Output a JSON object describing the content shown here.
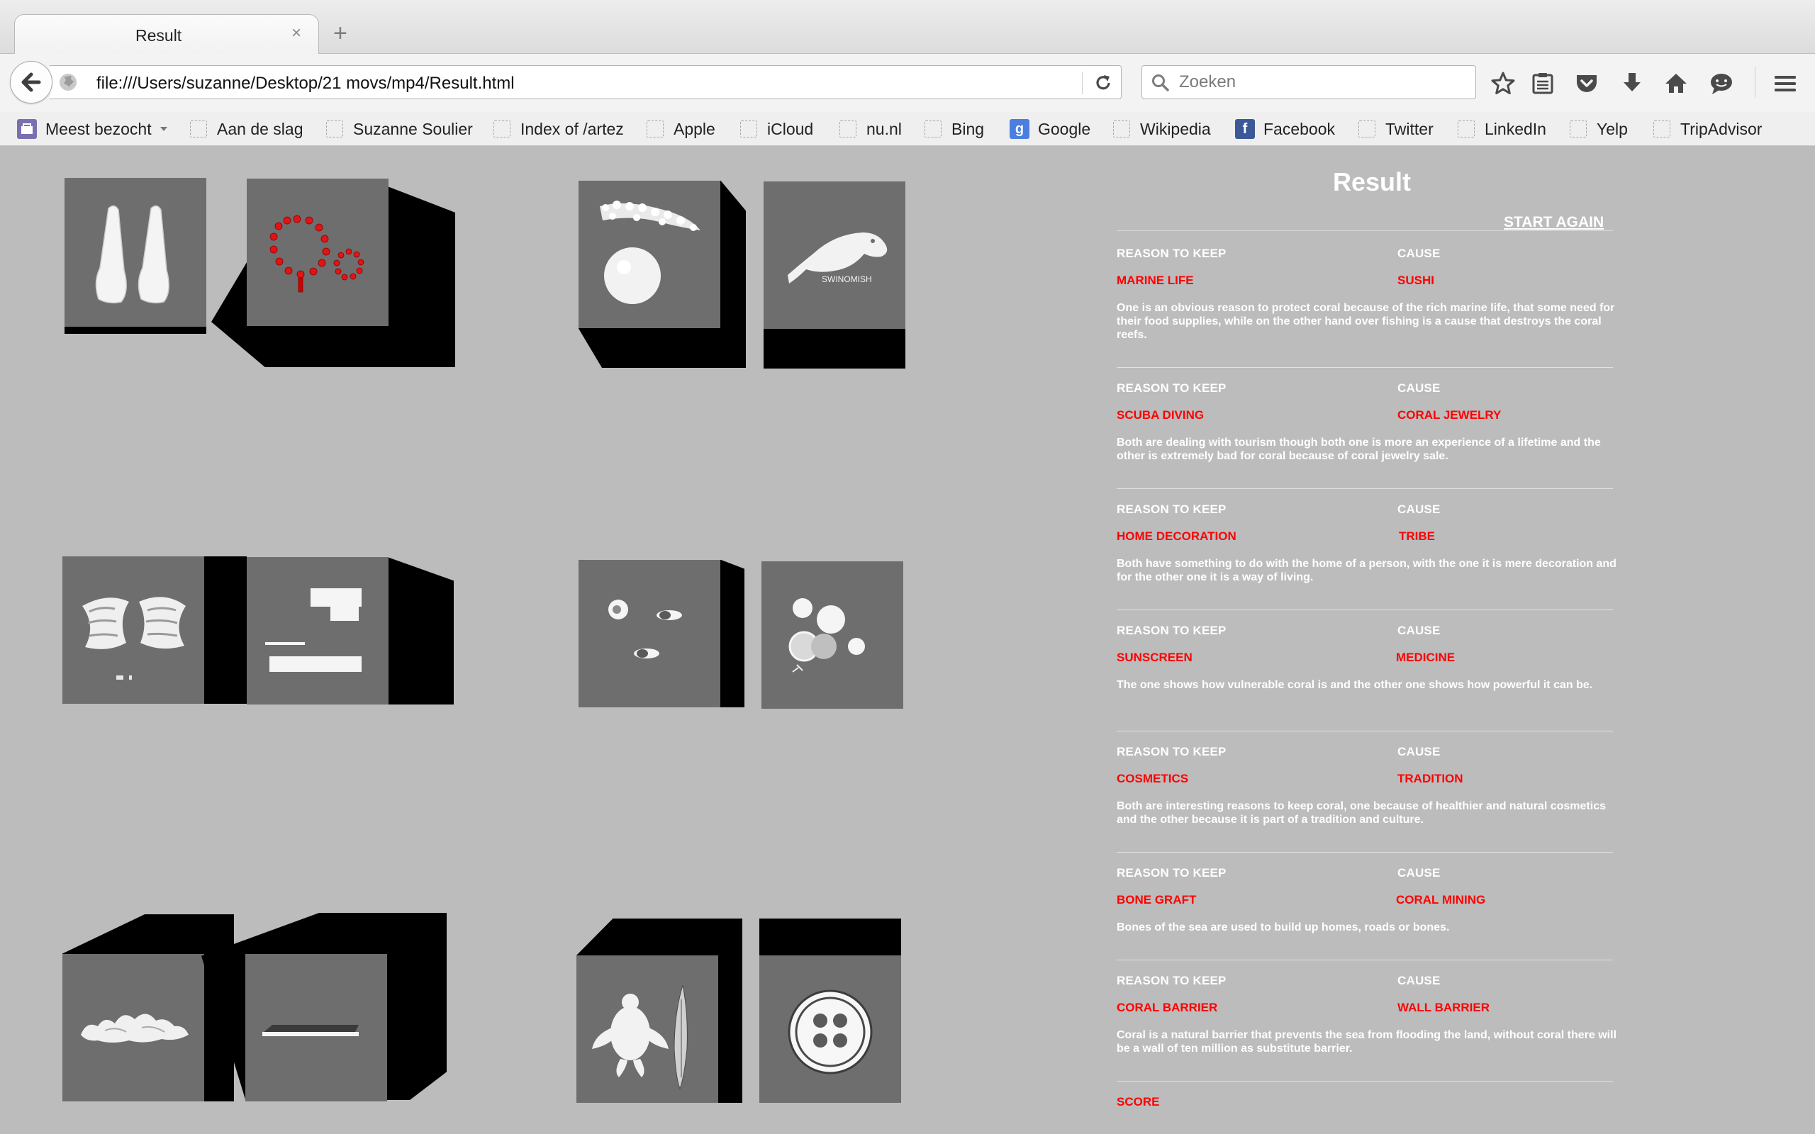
{
  "browser": {
    "tab_title": "Result",
    "tab_close": "×",
    "new_tab": "+",
    "url": "file:///Users/suzanne/Desktop/21 movs/mp4/Result.html",
    "search_placeholder": "Zoeken"
  },
  "bookmarks": [
    {
      "label": "Meest bezocht",
      "icon": "most-visited-icon"
    },
    {
      "label": "Aan de slag",
      "icon": "placeholder"
    },
    {
      "label": "Suzanne Soulier",
      "icon": "placeholder"
    },
    {
      "label": "Index of /artez",
      "icon": "placeholder"
    },
    {
      "label": "Apple",
      "icon": "placeholder"
    },
    {
      "label": "iCloud",
      "icon": "placeholder"
    },
    {
      "label": "nu.nl",
      "icon": "placeholder"
    },
    {
      "label": "Bing",
      "icon": "placeholder"
    },
    {
      "label": "Google",
      "icon": "google-icon"
    },
    {
      "label": "Wikipedia",
      "icon": "placeholder"
    },
    {
      "label": "Facebook",
      "icon": "facebook-icon"
    },
    {
      "label": "Twitter",
      "icon": "placeholder"
    },
    {
      "label": "LinkedIn",
      "icon": "placeholder"
    },
    {
      "label": "Yelp",
      "icon": "placeholder"
    },
    {
      "label": "TripAdvisor",
      "icon": "placeholder"
    }
  ],
  "cubes": [
    {
      "name": "cube-fins",
      "image": "swim-fins"
    },
    {
      "name": "cube-coral-jewelry",
      "image": "coral-bead-necklace"
    },
    {
      "name": "cube-coral-fish",
      "image": "coral-and-sponge"
    },
    {
      "name": "cube-salmon-logo",
      "image": "salmon-logo",
      "logo_text": "SWINOMISH"
    },
    {
      "name": "cube-shells",
      "image": "shells"
    },
    {
      "name": "cube-blocks",
      "image": "building-blocks"
    },
    {
      "name": "cube-pills",
      "image": "pills"
    },
    {
      "name": "cube-spheres",
      "image": "spheres"
    },
    {
      "name": "cube-coral-reef",
      "image": "coral-piece"
    },
    {
      "name": "cube-slab",
      "image": "slab"
    },
    {
      "name": "cube-turtle",
      "image": "turtle-and-fish"
    },
    {
      "name": "cube-button",
      "image": "button"
    }
  ],
  "result": {
    "title": "Result",
    "start_again": "START AGAIN",
    "labels": {
      "reason": "REASON TO KEEP",
      "cause": "CAUSE"
    },
    "entries": [
      {
        "reason": "MARINE LIFE",
        "cause": "SUSHI",
        "text": "One is an obvious reason to protect coral because of the rich marine life, that some need for their food supplies, while on the other hand over fishing is a cause that destroys the coral reefs."
      },
      {
        "reason": "SCUBA DIVING",
        "cause": "CORAL JEWELRY",
        "text": "Both are dealing with tourism though both one is more an experience of a lifetime and the other is extremely bad for coral because of coral jewelry sale."
      },
      {
        "reason": "HOME DECORATION",
        "cause": "TRIBE",
        "text": "Both have something to do with the home of a person, with the one it is mere decoration and for the other one it is a way of living."
      },
      {
        "reason": "SUNSCREEN",
        "cause": "MEDICINE",
        "text": "The one shows how vulnerable coral is and the other one shows how powerful it can be."
      },
      {
        "reason": "COSMETICS",
        "cause": "TRADITION",
        "text": "Both are interesting reasons to keep coral, one because of healthier and natural cosmetics and the other because it is part of a tradition and culture."
      },
      {
        "reason": "BONE GRAFT",
        "cause": "CORAL MINING",
        "text": "Bones of the sea are used to build up homes, roads or bones."
      },
      {
        "reason": "CORAL BARRIER",
        "cause": "WALL BARRIER",
        "text": "Coral is a natural barrier that prevents the sea from flooding the land, without coral there will be a wall of ten million as substitute barrier."
      }
    ],
    "score_label": "SCORE"
  },
  "colors": {
    "page_bg": "#bcbcbc",
    "accent": "#ff0000",
    "text": "#ffffff",
    "cube_face": "#6e6e6e",
    "cube_side": "#000000"
  }
}
